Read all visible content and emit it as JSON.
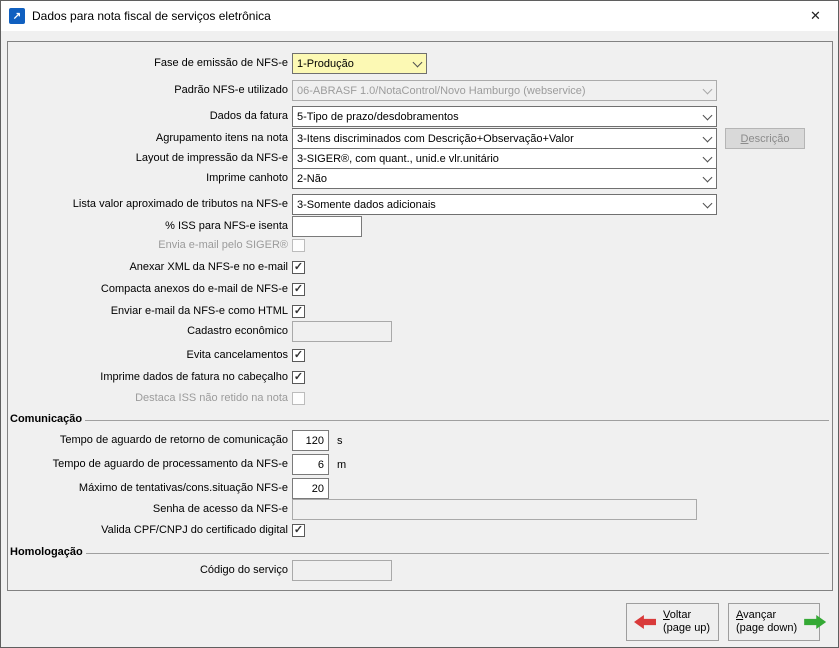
{
  "window": {
    "title": "Dados para nota fiscal de serviços eletrônica"
  },
  "icons": {
    "app": "↗",
    "close": "✕",
    "check": "✓"
  },
  "colors": {
    "highlight_yellow": "#fcf9b4",
    "titlebar_icon_blue": "#1060c0",
    "back_arrow_red": "#d93a3a",
    "forward_arrow_green": "#35a935"
  },
  "main": {
    "rows": [
      {
        "type": "combo",
        "label": "Fase de emissão de NFS-e",
        "value": "1-Produção",
        "highlight": true
      },
      {
        "type": "combo",
        "label": "Padrão NFS-e utilizado",
        "value": "06-ABRASF 1.0/NotaControl/Novo Hamburgo (webservice)",
        "disabled": true
      },
      {
        "type": "combo",
        "label": "Dados da fatura",
        "value": "5-Tipo de prazo/desdobramentos"
      },
      {
        "type": "combo",
        "label": "Agrupamento itens na nota",
        "value": "3-Itens discriminados com Descrição+Observação+Valor",
        "side_button": "Descrição"
      },
      {
        "type": "combo",
        "label": "Layout de impressão da NFS-e",
        "value": "3-SIGER®, com quant., unid.e vlr.unitário"
      },
      {
        "type": "combo",
        "label": "Imprime canhoto",
        "value": "2-Não"
      },
      {
        "type": "combo",
        "label": "Lista valor aproximado de tributos na NFS-e",
        "value": "3-Somente dados adicionais"
      },
      {
        "type": "input",
        "label": "% ISS para NFS-e isenta",
        "value": ""
      },
      {
        "type": "checkbox",
        "label": "Envia e-mail pelo SIGER®",
        "checked": false,
        "disabled": true
      },
      {
        "type": "checkbox",
        "label": "Anexar XML da NFS-e no e-mail",
        "checked": true
      },
      {
        "type": "checkbox",
        "label": "Compacta anexos do e-mail de NFS-e",
        "checked": true
      },
      {
        "type": "checkbox",
        "label": "Enviar e-mail da NFS-e como HTML",
        "checked": true
      },
      {
        "type": "input",
        "label": "Cadastro econômico",
        "value": "",
        "disabled": true
      },
      {
        "type": "checkbox",
        "label": "Evita cancelamentos",
        "checked": true
      },
      {
        "type": "checkbox",
        "label": "Imprime dados de fatura no cabeçalho",
        "checked": true
      },
      {
        "type": "checkbox",
        "label": "Destaca ISS não retido na nota",
        "checked": false,
        "disabled": true
      }
    ]
  },
  "comunicacao": {
    "title": "Comunicação",
    "rows": [
      {
        "type": "number",
        "label": "Tempo de aguardo de retorno de comunicação",
        "value": "120",
        "suffix": "s"
      },
      {
        "type": "number",
        "label": "Tempo de aguardo de processamento da NFS-e",
        "value": "6",
        "suffix": "m"
      },
      {
        "type": "number",
        "label": "Máximo de tentativas/cons.situação NFS-e",
        "value": "20",
        "suffix": ""
      },
      {
        "type": "input",
        "label": "Senha de acesso da NFS-e",
        "value": "",
        "disabled": true,
        "wide": true
      },
      {
        "type": "checkbox",
        "label": "Valida CPF/CNPJ do certificado digital",
        "checked": true
      }
    ]
  },
  "homologacao": {
    "title": "Homologação",
    "rows": [
      {
        "type": "input",
        "label": "Código do serviço",
        "value": "",
        "disabled": true
      }
    ]
  },
  "footer": {
    "back": {
      "label": "Voltar",
      "sublabel": "(page up)"
    },
    "forward": {
      "label": "Avançar",
      "sublabel": "(page down)"
    }
  }
}
